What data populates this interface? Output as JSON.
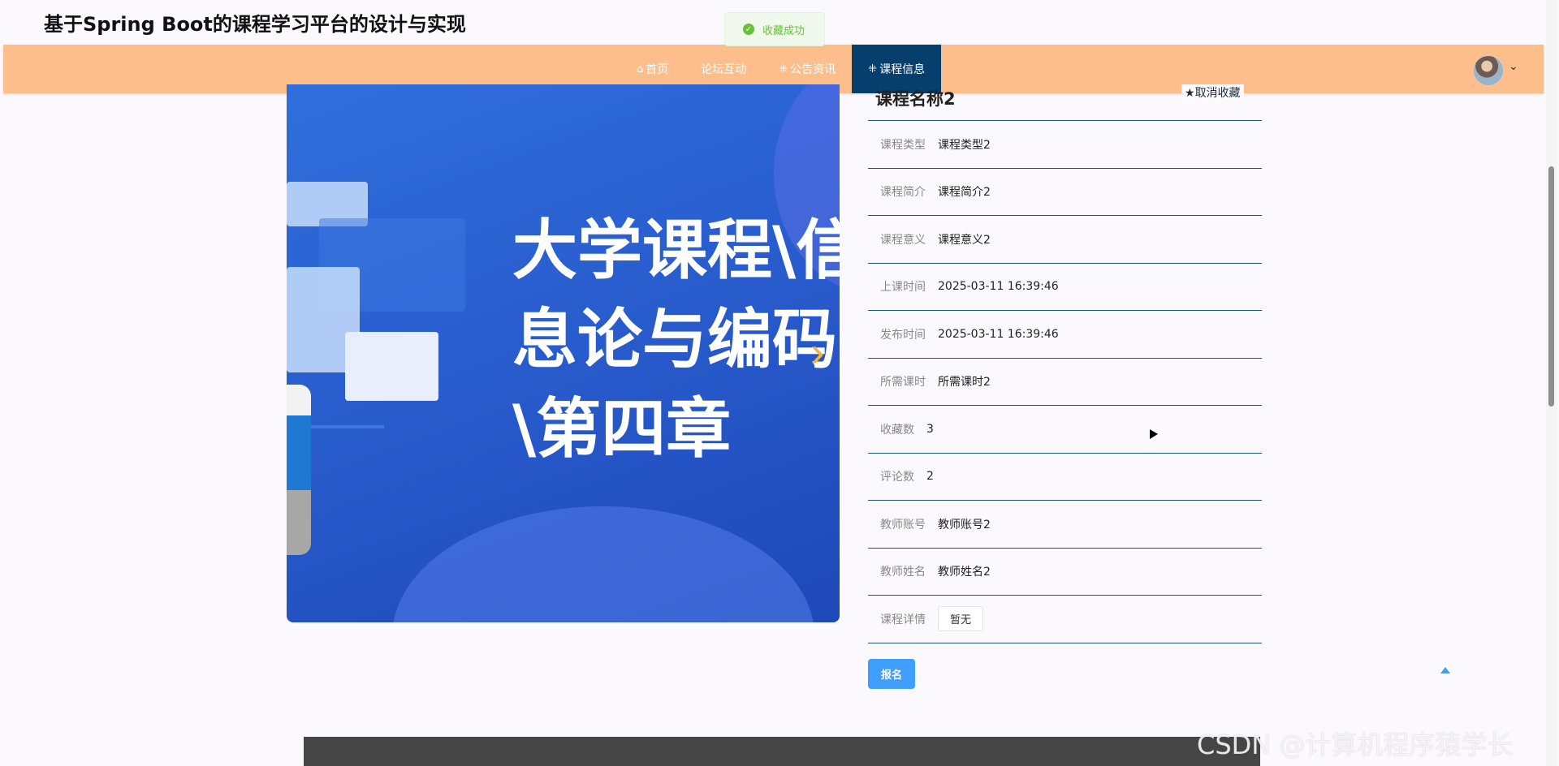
{
  "site": {
    "title": "基于Spring Boot的课程学习平台的设计与实现"
  },
  "toast": {
    "message": "收藏成功"
  },
  "nav": {
    "items": [
      {
        "label": "首页",
        "icon": "home-icon",
        "glyph": "⌂"
      },
      {
        "label": "论坛互动",
        "icon": "",
        "glyph": ""
      },
      {
        "label": "公告资讯",
        "icon": "grid-icon",
        "glyph": "⁜"
      },
      {
        "label": "课程信息",
        "icon": "grid-icon",
        "glyph": "⁜",
        "active": true
      }
    ]
  },
  "image": {
    "lines": [
      "大学课程\\信",
      "息论与编码",
      "\\第四章"
    ]
  },
  "course": {
    "name": "课程名称2",
    "favorite_label": "取消收藏",
    "fields": [
      {
        "label": "课程类型",
        "value": "课程类型2"
      },
      {
        "label": "课程简介",
        "value": "课程简介2"
      },
      {
        "label": "课程意义",
        "value": "课程意义2"
      },
      {
        "label": "上课时间",
        "value": "2025-03-11 16:39:46"
      },
      {
        "label": "发布时间",
        "value": "2025-03-11 16:39:46"
      },
      {
        "label": "所需课时",
        "value": "所需课时2"
      },
      {
        "label": "收藏数",
        "value": "3"
      },
      {
        "label": "评论数",
        "value": "2"
      },
      {
        "label": "教师账号",
        "value": "教师账号2"
      },
      {
        "label": "教师姓名",
        "value": "教师姓名2"
      },
      {
        "label": "课程详情",
        "value": "暂无"
      }
    ],
    "signup_label": "报名"
  },
  "watermark": "CSDN @计算机程序猿学长",
  "colors": {
    "navbar": "#fdbe8b",
    "nav_active": "#063f6e",
    "primary": "#409eff",
    "success": "#67c23a"
  }
}
